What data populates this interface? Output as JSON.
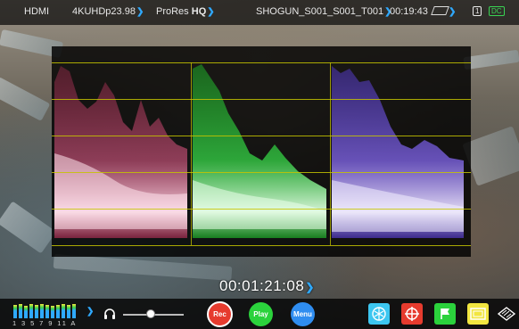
{
  "top_bar": {
    "input": "HDMI",
    "resolution": "4KUHDp23.98",
    "codec": "ProRes",
    "codec_quality": "HQ",
    "filename": "SHOGUN_S001_S001_T001",
    "time_remaining": "00:19:43",
    "record_slot": "1",
    "power": "DC"
  },
  "scope": {
    "type": "RGB Parade Waveform",
    "channels": [
      "red",
      "green",
      "blue"
    ],
    "colors": {
      "red": "#d9345f",
      "green": "#2fe03a",
      "blue": "#7a5cff",
      "graticule": "#c6c400"
    }
  },
  "timecode": "00:01:21:08",
  "bottom_bar": {
    "audio_channels_label": "1 3 5 7 9 11 A",
    "audio_levels": [
      0.85,
      0.9,
      0.8,
      0.88,
      0.82,
      0.9,
      0.86,
      0.8,
      0.84,
      0.88,
      0.83,
      0.87
    ],
    "headphone_volume": 0.45,
    "rec_label": "Rec",
    "play_label": "Play",
    "menu_label": "Menu",
    "icons": [
      "focus-peaking-icon",
      "crosshair-icon",
      "flag-icon",
      "frame-guides-icon",
      "zebra-icon"
    ],
    "accent_colors": {
      "rec": "#e63b2e",
      "play": "#2bd23c",
      "menu": "#2f8df0",
      "cyan": "#3cc6f0",
      "yellow": "#f2e640"
    }
  }
}
